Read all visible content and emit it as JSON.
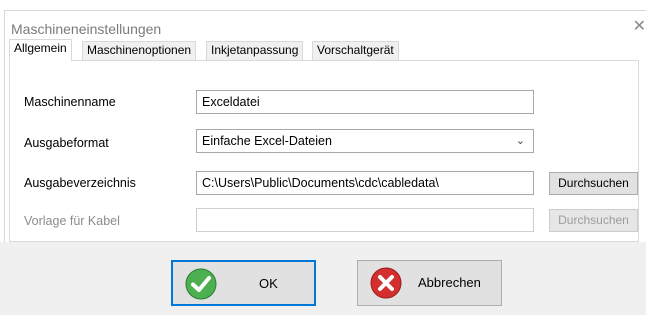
{
  "window": {
    "title": "Maschineneinstellungen",
    "close_glyph": "✕"
  },
  "tabs": [
    {
      "label": "Allgemein",
      "active": true
    },
    {
      "label": "Maschinenoptionen",
      "active": false
    },
    {
      "label": "Inkjetanpassung",
      "active": false
    },
    {
      "label": "Vorschaltgerät",
      "active": false
    }
  ],
  "form": {
    "machine_name": {
      "label": "Maschinenname",
      "value": "Exceldatei"
    },
    "output_format": {
      "label": "Ausgabeformat",
      "value": "Einfache Excel-Dateien",
      "arrow": "⌄"
    },
    "output_dir": {
      "label": "Ausgabeverzeichnis",
      "value": "C:\\Users\\Public\\Documents\\cdc\\cabledata\\",
      "browse_label": "Durchsuchen"
    },
    "cable_template": {
      "label": "Vorlage für Kabel",
      "value": "",
      "browse_label": "Durchsuchen",
      "disabled": true
    }
  },
  "buttons": {
    "ok": {
      "label": "OK",
      "icon": "check-icon",
      "color": "#4caf50"
    },
    "cancel": {
      "label": "Abbrechen",
      "icon": "cancel-icon",
      "color": "#d32f2f"
    }
  },
  "colors": {
    "focus_border": "#0078d7",
    "footer_bg": "#f0f0f0"
  }
}
